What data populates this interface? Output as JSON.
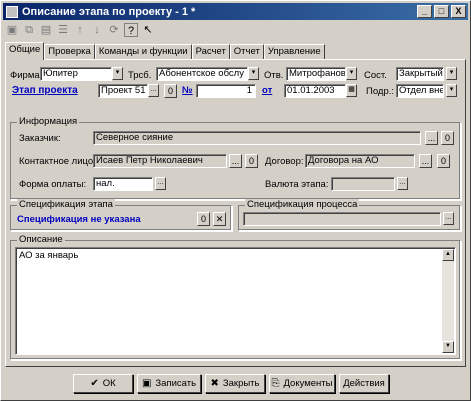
{
  "window": {
    "title": "Описание этапа по проекту - 1 *",
    "minimize": "_",
    "maximize": "□",
    "close": "X"
  },
  "toolbar": {
    "icons": [
      "save-icon",
      "copy-icon",
      "print-icon",
      "list-icon",
      "up-arrow-icon",
      "down-arrow-icon",
      "refresh-icon",
      "help-icon",
      "pointer-help-icon"
    ]
  },
  "tabs": [
    "Общие",
    "Проверка",
    "Команды и функции",
    "Расчет",
    "Отчет",
    "Управление"
  ],
  "header_fields": {
    "firm_label": "Фирма",
    "firm_value": "Юпитер",
    "resp_label": "Трсб.",
    "resp_value": "Абонентское обслу",
    "otv_label": "Отв.",
    "otv_value": "Митрофанов А",
    "sost_label": "Сост.",
    "sost_value": "Закрытый",
    "stage_link": "Этап проекта",
    "project_value": "Проект 51",
    "zero_btn": "0",
    "num_label": "№",
    "num_value": "1",
    "ot_link": "от",
    "date_value": "01.01.2003",
    "podr_label": "Подр.:",
    "podr_value": "Отдел внед"
  },
  "info_group": {
    "title": "Информация",
    "customer_label": "Заказчик:",
    "customer_value": "Северное сияние",
    "contact_label": "Контактное лицо:",
    "contact_value": "Исаев Петр Николаевич",
    "contract_label": "Договор:",
    "contract_value": "Договора на АО",
    "payform_label": "Форма оплаты:",
    "payform_value": "нал.",
    "currency_label": "Валюта этапа:",
    "currency_value": "",
    "btn_dots": "...",
    "btn_zero": "0"
  },
  "spec_stage": {
    "title": "Спецификация этапа",
    "value": "Спецификация не указана",
    "btn_zero": "0",
    "btn_clear": "✕"
  },
  "spec_process": {
    "title": "Спецификация процесса",
    "value": ""
  },
  "description": {
    "title": "Описание",
    "text": "АО за январь"
  },
  "buttons": {
    "ok": "ОК",
    "save": "Записать",
    "close": "Закрыть",
    "docs": "Документы",
    "actions": "Действия"
  }
}
